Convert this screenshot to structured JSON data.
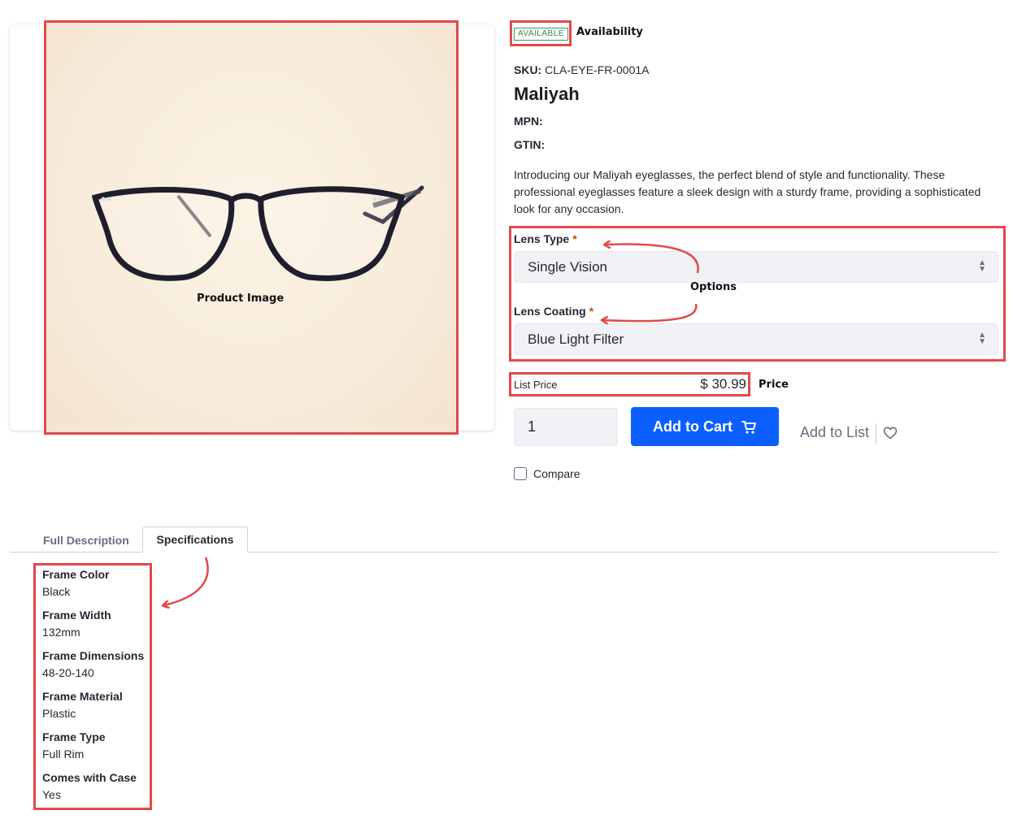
{
  "image": {
    "annotation_label": "Product Image"
  },
  "availability": {
    "badge": "AVAILABLE",
    "annotation_label": "Availability"
  },
  "product": {
    "sku_label": "SKU:",
    "sku_value": "CLA-EYE-FR-0001A",
    "name": "Maliyah",
    "mpn_label": "MPN:",
    "gtin_label": "GTIN:",
    "description": "Introducing our Maliyah eyeglasses, the perfect blend of style and functionality. These professional eyeglasses feature a sleek design with a sturdy frame, providing a sophisticated look for any occasion."
  },
  "options": {
    "annotation_label": "Options",
    "lens_type": {
      "label": "Lens Type",
      "required_marker": "*",
      "value": "Single Vision"
    },
    "lens_coating": {
      "label": "Lens Coating",
      "required_marker": "*",
      "value": "Blue Light Filter"
    }
  },
  "price": {
    "list_label": "List Price",
    "list_value": "$ 30.99",
    "annotation_label": "Price"
  },
  "cart": {
    "quantity": "1",
    "add_to_cart_label": "Add to Cart",
    "add_to_list_label": "Add to List",
    "compare_label": "Compare"
  },
  "tabs": [
    {
      "label": "Full Description",
      "active": false
    },
    {
      "label": "Specifications",
      "active": true
    }
  ],
  "specifications": [
    {
      "name": "Frame Color",
      "value": "Black"
    },
    {
      "name": "Frame Width",
      "value": "132mm"
    },
    {
      "name": "Frame Dimensions",
      "value": "48-20-140"
    },
    {
      "name": "Frame Material",
      "value": "Plastic"
    },
    {
      "name": "Frame Type",
      "value": "Full Rim"
    },
    {
      "name": "Comes with Case",
      "value": "Yes"
    }
  ],
  "colors": {
    "annotation_red": "#e2494b",
    "primary_blue": "#0b5fff",
    "available_green": "#2f8a4b"
  }
}
